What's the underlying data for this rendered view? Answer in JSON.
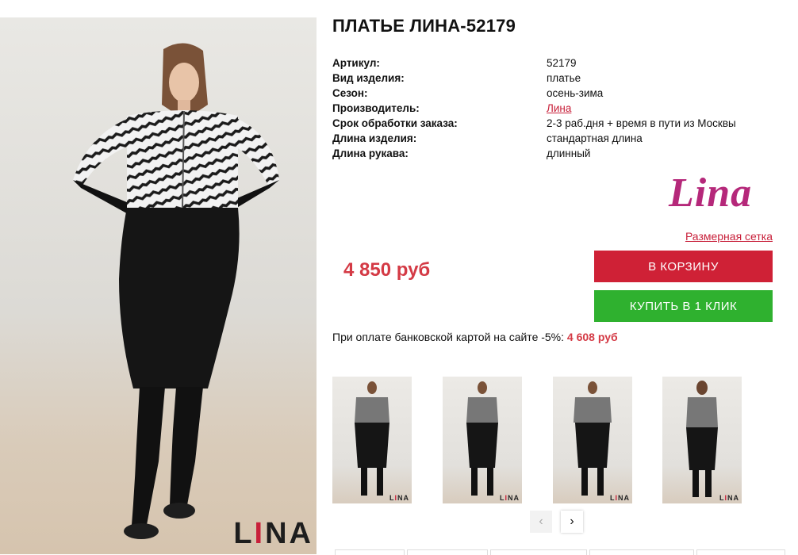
{
  "product": {
    "title": "ПЛАТЬЕ ЛИНА-52179",
    "specs": [
      {
        "label": "Артикул:",
        "value": "52179"
      },
      {
        "label": "Вид изделия:",
        "value": "платье"
      },
      {
        "label": "Сезон:",
        "value": "осень-зима"
      },
      {
        "label": "Производитель:",
        "value": "Лина",
        "link": true
      },
      {
        "label": "Срок обработки заказа:",
        "value": "2-3 раб.дня + время в пути из Москвы"
      },
      {
        "label": "Длина изделия:",
        "value": "стандартная длина"
      },
      {
        "label": "Длина рукава:",
        "value": "длинный"
      }
    ],
    "logo_text": "Lina",
    "size_chart_link": "Размерная сетка",
    "price": "4 850 руб",
    "add_to_cart_label": "В КОРЗИНУ",
    "one_click_label": "КУПИТЬ В 1 КЛИК",
    "card_discount_text": "При оплате банковской картой на сайте -5%: ",
    "card_discount_price": "4 608 руб"
  },
  "photo_brand": {
    "pre": "L",
    "accent": "I",
    "post": "NA"
  },
  "thumbnails": [
    {
      "name": "thumb-front"
    },
    {
      "name": "thumb-pocket"
    },
    {
      "name": "thumb-front-2"
    },
    {
      "name": "thumb-back"
    }
  ],
  "gallery_nav": {
    "prev_icon": "chevron-left",
    "next_icon": "chevron-right"
  },
  "colors": {
    "accent_red": "#cf2136",
    "green": "#2fb12f",
    "price_red": "#d43a45",
    "logo_magenta": "#b5287a"
  }
}
